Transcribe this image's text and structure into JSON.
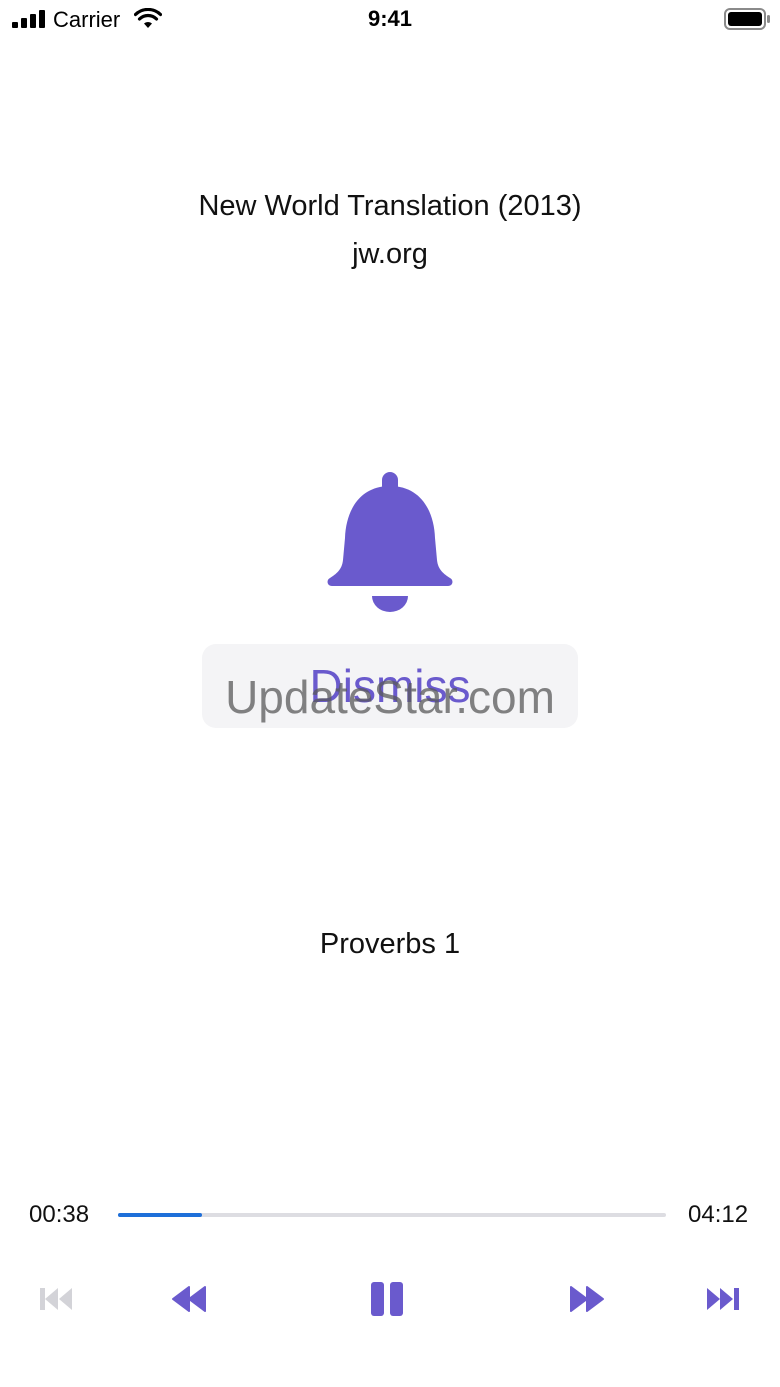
{
  "status_bar": {
    "carrier": "Carrier",
    "time": "9:41"
  },
  "header": {
    "title": "New World Translation (2013)",
    "subtitle": "jw.org"
  },
  "alert": {
    "icon": "bell-icon",
    "dismiss_label": "Dismiss"
  },
  "watermark": "UpdateStar.com",
  "chapter": "Proverbs 1",
  "player": {
    "elapsed": "00:38",
    "duration": "04:12",
    "progress_fraction": 0.154,
    "controls": [
      "skip-back-icon",
      "rewind-icon",
      "pause-icon",
      "fast-forward-icon",
      "skip-forward-icon"
    ]
  },
  "colors": {
    "accent": "#6a5acd",
    "progress": "#1e6fd9",
    "disabled": "#d0d0d4"
  }
}
